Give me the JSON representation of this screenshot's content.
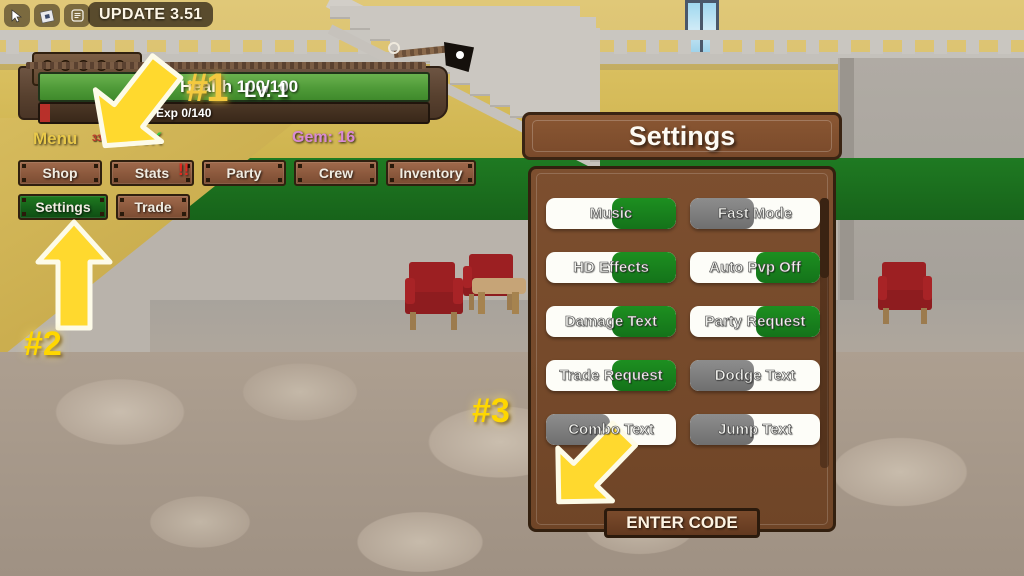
{
  "topbar": {
    "icons": [
      "cursor-icon",
      "roblox-logo-icon",
      "chat-icon"
    ],
    "update_badge": "UPDATE 3.51"
  },
  "hud": {
    "rank": "#1",
    "level": "Lv. 1",
    "health": "Health 100/100",
    "exp": "Exp 0/140",
    "menu_label": "Menu",
    "menu_sub": "33",
    "money": "$200K",
    "gem": "Gem: 16"
  },
  "menu_buttons": [
    {
      "label": "Shop",
      "active": false
    },
    {
      "label": "Stats",
      "active": false
    },
    {
      "label": "Party",
      "active": false
    },
    {
      "label": "Crew",
      "active": false
    },
    {
      "label": "Inventory",
      "active": false
    },
    {
      "label": "Settings",
      "active": true
    },
    {
      "label": "Trade",
      "active": false
    }
  ],
  "stats_badge": "!!",
  "settings": {
    "title": "Settings",
    "toggles": [
      {
        "label": "Music",
        "state": "on"
      },
      {
        "label": "Fast Mode",
        "state": "off"
      },
      {
        "label": "HD Effects",
        "state": "on"
      },
      {
        "label": "Auto Pvp Off",
        "state": "on"
      },
      {
        "label": "Damage Text",
        "state": "on"
      },
      {
        "label": "Party Request",
        "state": "on"
      },
      {
        "label": "Trade Request",
        "state": "on"
      },
      {
        "label": "Dodge Text",
        "state": "off"
      },
      {
        "label": "Combo Text",
        "state": "off"
      },
      {
        "label": "Jump Text",
        "state": "off"
      }
    ],
    "enter_code": "ENTER CODE"
  },
  "annotations": [
    {
      "label": "#1",
      "arrow": "arrow-down-left"
    },
    {
      "label": "#2",
      "arrow": "arrow-up"
    },
    {
      "label": "#3",
      "arrow": "arrow-down-right"
    }
  ],
  "colors": {
    "accent_yellow": "#ffd700",
    "toggle_on": "#1d8f20",
    "toggle_off": "#8d8d8d",
    "panel_brown": "#7d4f2f",
    "health_green": "#4f9a38",
    "money_green": "#2ecc40",
    "gem_purple": "#d98ad4"
  }
}
